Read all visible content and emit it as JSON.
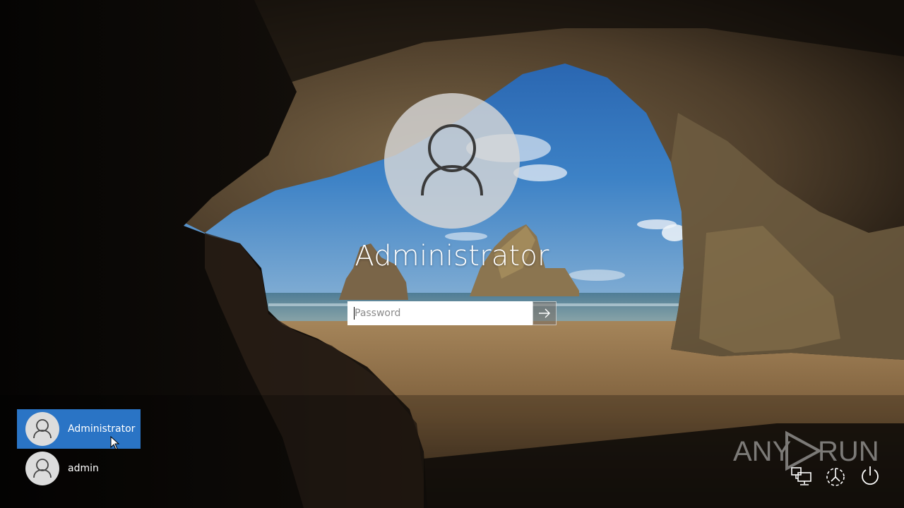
{
  "login": {
    "username": "Administrator",
    "password_placeholder": "Password",
    "submit_icon": "arrow-right-icon"
  },
  "user_list": [
    {
      "name": "Administrator",
      "selected": true,
      "icon": "user-icon"
    },
    {
      "name": "admin",
      "selected": false,
      "icon": "user-icon"
    }
  ],
  "watermark": {
    "left": "ANY",
    "right": "RUN",
    "icon": "play-triangle-icon"
  },
  "system_buttons": [
    {
      "name": "network",
      "icon": "network-icon"
    },
    {
      "name": "ease-of-access",
      "icon": "ease-of-access-icon"
    },
    {
      "name": "power",
      "icon": "power-icon"
    }
  ],
  "colors": {
    "selected_user_bg": "#2a74c5",
    "avatar_bg": "#dcdcdc",
    "text": "#ffffff"
  }
}
